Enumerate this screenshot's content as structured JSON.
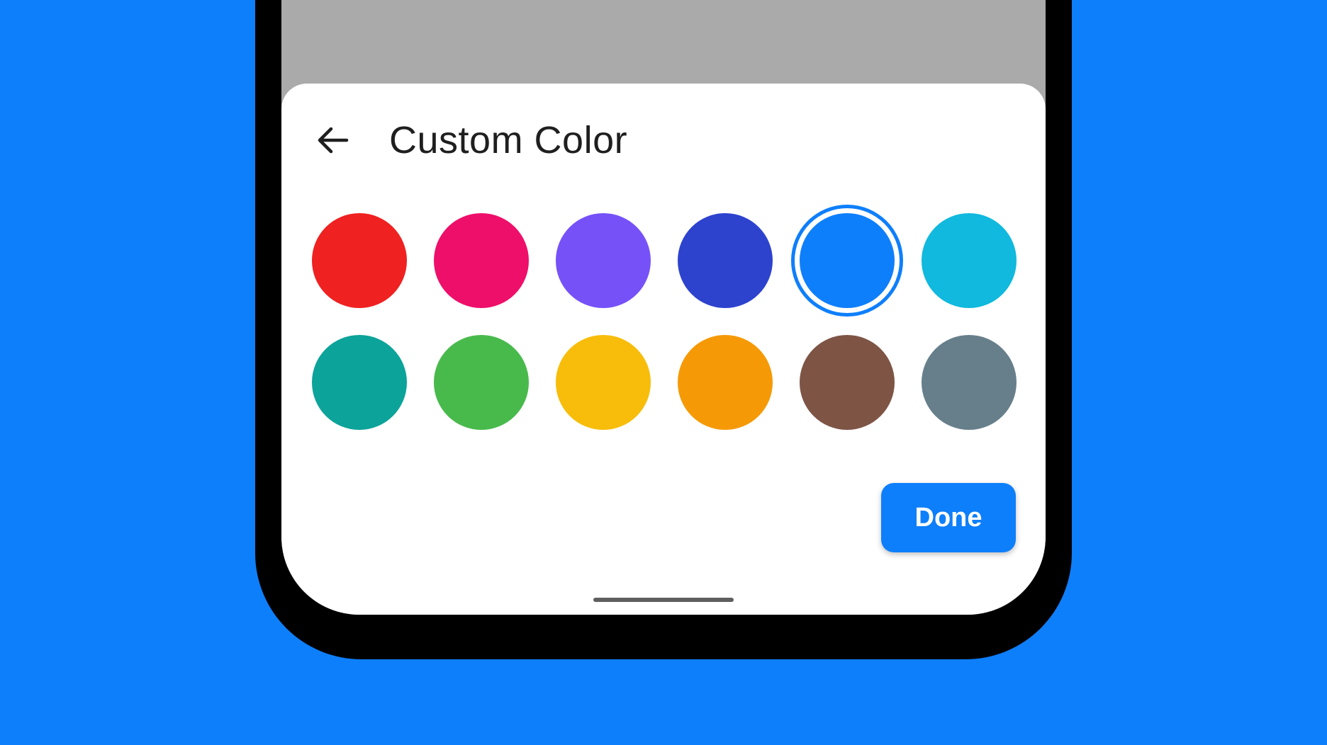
{
  "header": {
    "title": "Custom Color",
    "back_icon": "arrow-left-icon"
  },
  "colors": {
    "background": "#0E7FFB",
    "accent": "#0E7FFB"
  },
  "swatches": [
    {
      "name": "red",
      "color": "#EF2121",
      "selected": false
    },
    {
      "name": "pink",
      "color": "#EE0F6A",
      "selected": false
    },
    {
      "name": "purple",
      "color": "#7651F8",
      "selected": false
    },
    {
      "name": "indigo",
      "color": "#2D43CE",
      "selected": false
    },
    {
      "name": "blue",
      "color": "#0E7FFB",
      "selected": true
    },
    {
      "name": "cyan",
      "color": "#10B9DD",
      "selected": false
    },
    {
      "name": "teal",
      "color": "#0CA39A",
      "selected": false
    },
    {
      "name": "green",
      "color": "#48BA4C",
      "selected": false
    },
    {
      "name": "yellow",
      "color": "#F7BD0A",
      "selected": false
    },
    {
      "name": "orange",
      "color": "#F59A06",
      "selected": false
    },
    {
      "name": "brown",
      "color": "#7E5445",
      "selected": false
    },
    {
      "name": "gray",
      "color": "#667F8B",
      "selected": false
    }
  ],
  "actions": {
    "done_label": "Done"
  }
}
